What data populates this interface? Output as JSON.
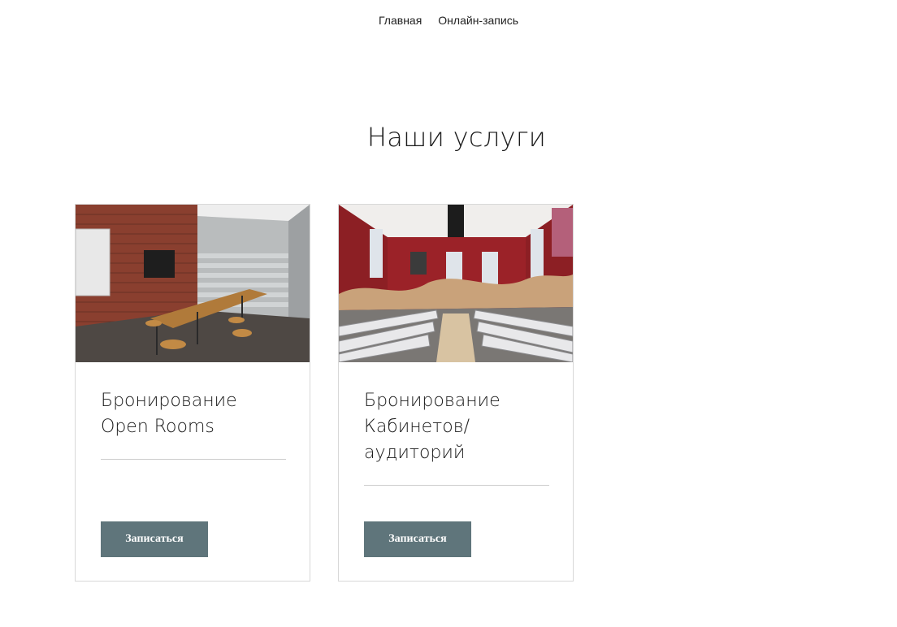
{
  "nav": {
    "items": [
      {
        "label": "Главная"
      },
      {
        "label": "Онлайн-запись"
      }
    ]
  },
  "services": {
    "title": "Наши услуги",
    "cards": [
      {
        "title_line1": "Бронирование",
        "title_line2": "Open Rooms",
        "image_icon": "open-room-photo",
        "button_label": "Записаться"
      },
      {
        "title_line1": "Бронирование",
        "title_line2": "Кабинетов/",
        "title_line3": "аудиторий",
        "image_icon": "auditorium-photo",
        "button_label": "Записаться"
      }
    ]
  },
  "colors": {
    "button_bg": "#5f757b",
    "card_border": "#d8d8d8",
    "text": "#1a1a1a"
  }
}
